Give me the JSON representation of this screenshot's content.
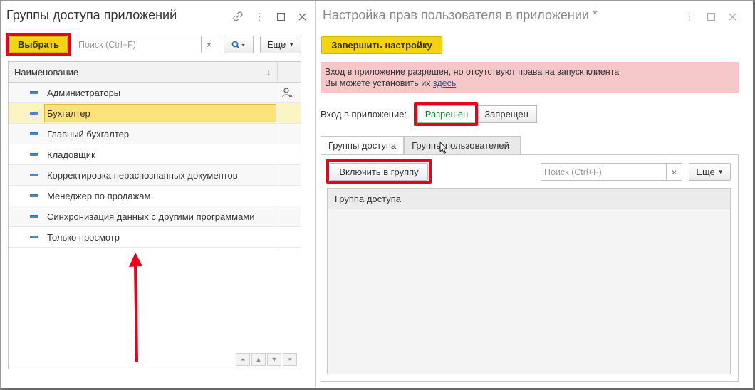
{
  "left_window": {
    "title": "Группы доступа приложений",
    "select_button": "Выбрать",
    "search_placeholder": "Поиск (Ctrl+F)",
    "search_clear": "×",
    "more_button": "Еще",
    "column_header": "Наименование",
    "sort_indicator": "↓",
    "rows": [
      {
        "label": "Администраторы",
        "selected": false
      },
      {
        "label": "Бухгалтер",
        "selected": true
      },
      {
        "label": "Главный бухгалтер",
        "selected": false
      },
      {
        "label": "Кладовщик",
        "selected": false
      },
      {
        "label": "Корректировка нераспознанных документов",
        "selected": false
      },
      {
        "label": "Менеджер по продажам",
        "selected": false
      },
      {
        "label": "Синхронизация данных с другими программами",
        "selected": false
      },
      {
        "label": "Только просмотр",
        "selected": false
      }
    ]
  },
  "right_window": {
    "title": "Настройка прав пользователя в приложении *",
    "finish_button": "Завершить настройку",
    "warning_line1": "Вход в приложение разрешен, но отсутствуют права на запуск клиента",
    "warning_line2_prefix": "Вы можете установить их ",
    "warning_link": "здесь",
    "login_label": "Вход в приложение:",
    "allowed_button": "Разрешен",
    "denied_button": "Запрещен",
    "tabs": [
      "Группы доступа",
      "Группы пользователей"
    ],
    "include_button": "Включить в группу",
    "search_placeholder": "Поиск (Ctrl+F)",
    "search_clear": "×",
    "more_button": "Еще",
    "column_header": "Группа доступа"
  },
  "colors": {
    "highlight": "#e8001c",
    "yellow_button": "#f5d313",
    "warning_bg": "#f5c7c9",
    "selected_row": "#fbe27a",
    "allowed_text": "#1a8a3a"
  }
}
